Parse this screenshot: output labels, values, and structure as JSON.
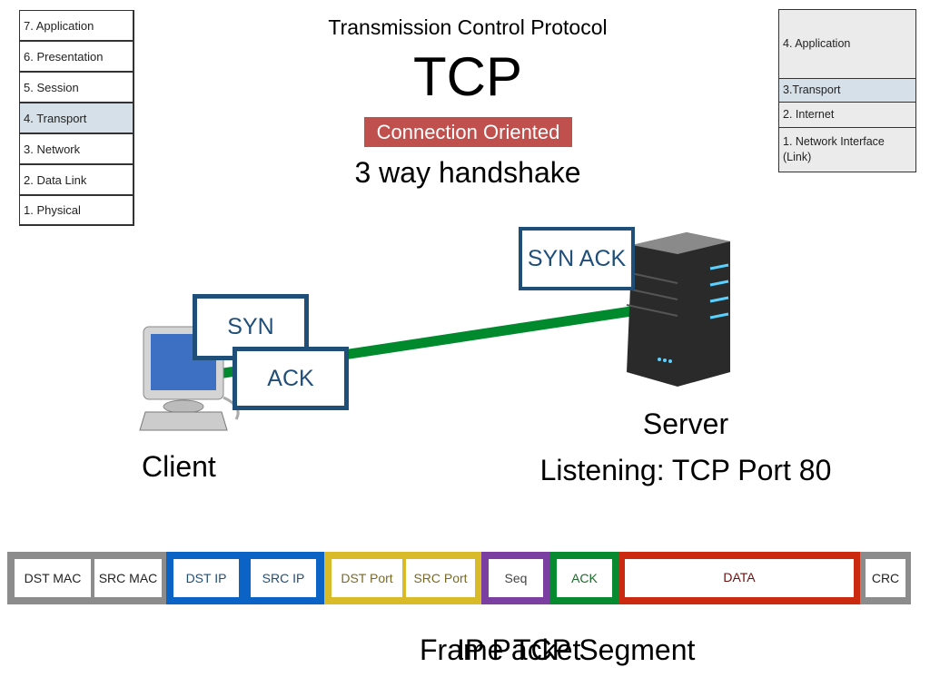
{
  "osi_layers": [
    "7. Application",
    "6. Presentation",
    "5. Session",
    "4. Transport",
    "3. Network",
    "2. Data Link",
    "1. Physical"
  ],
  "tcpip_layers": [
    "4. Application",
    "3.Transport",
    "2. Internet",
    "1. Network Interface (Link)"
  ],
  "title": "Transmission Control Protocol",
  "acronym": "TCP",
  "badge": "Connection Oriented",
  "subtitle": "3 way handshake",
  "messages": {
    "syn": "SYN",
    "syn_ack": "SYN ACK",
    "ack": "ACK"
  },
  "client_label": "Client",
  "server_label": "Server",
  "server_status": "Listening: TCP Port 80",
  "packet_fields": [
    "DST MAC",
    "SRC MAC",
    "DST IP",
    "SRC IP",
    "DST Port",
    "SRC Port",
    "Seq",
    "ACK",
    "DATA",
    "CRC"
  ],
  "pdu_labels": [
    "Frame",
    "IP Packet",
    "TCP Segment"
  ],
  "colors": {
    "highlight": "#d6e0e8",
    "message_border": "#1f4e79",
    "link": "#008a2e",
    "badge": "#c0504d",
    "mac": "#8c8c8c",
    "ip": "#0b63c5",
    "port": "#d9bb2a",
    "seq": "#7a3fa0",
    "ack": "#088a30",
    "data": "#cc2a10"
  }
}
